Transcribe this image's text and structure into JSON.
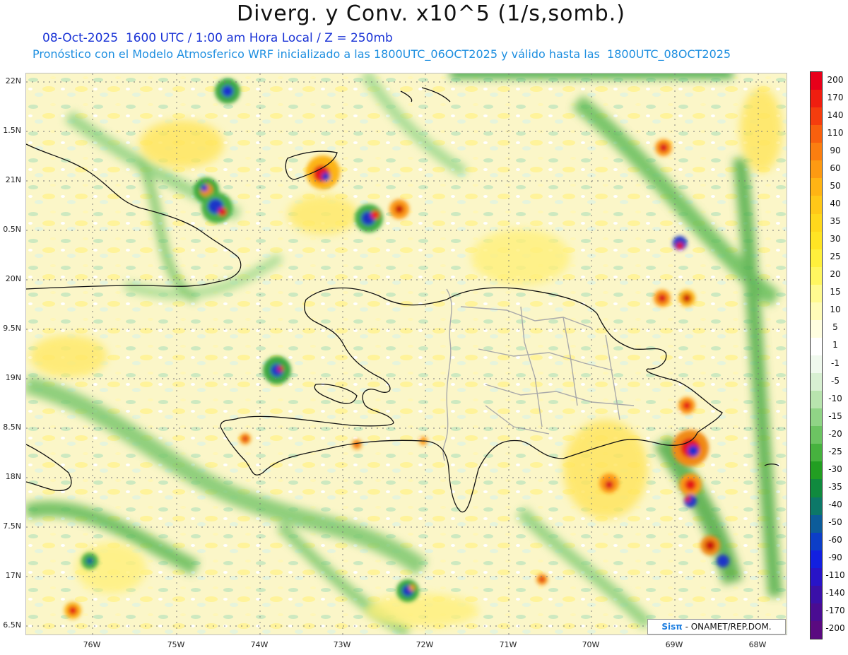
{
  "header": {
    "title": "Diverg. y Conv. x10^5 (1/s,somb.)",
    "line1": "08-Oct-2025  1600 UTC / 1:00 am Hora Local / Z = 250mb",
    "line2": "Pronóstico con el Modelo Atmosferico WRF inicializado a las 1800UTC_06OCT2025 y válido hasta las  1800UTC_08OCT2025"
  },
  "axes": {
    "lat_labels": [
      "22N",
      "1.5N",
      "21N",
      "0.5N",
      "20N",
      "9.5N",
      "19N",
      "8.5N",
      "18N",
      "7.5N",
      "17N",
      "6.5N"
    ],
    "lon_labels": [
      "76W",
      "75W",
      "74W",
      "73W",
      "72W",
      "71W",
      "70W",
      "69W",
      "68W"
    ]
  },
  "colorbar": {
    "labels": [
      "200",
      "170",
      "140",
      "110",
      "90",
      "60",
      "50",
      "40",
      "35",
      "30",
      "25",
      "20",
      "15",
      "10",
      "5",
      "1",
      "-1",
      "-5",
      "-10",
      "-15",
      "-20",
      "-25",
      "-30",
      "-35",
      "-40",
      "-50",
      "-60",
      "-90",
      "-110",
      "-140",
      "-170",
      "-200"
    ],
    "colors": [
      "#e8001a",
      "#f01e10",
      "#f53d0e",
      "#f8600e",
      "#fb7e10",
      "#fd9a12",
      "#ffb414",
      "#ffc818",
      "#ffd81c",
      "#ffe424",
      "#fff03c",
      "#fff660",
      "#fffa90",
      "#fffcb8",
      "#fffee0",
      "#ffffff",
      "#f0f9ee",
      "#d8f0d2",
      "#b8e4ae",
      "#90d486",
      "#6cc462",
      "#46b23e",
      "#229e22",
      "#108a3e",
      "#0c7868",
      "#0c5c9a",
      "#0c3ec8",
      "#1220e0",
      "#2814c8",
      "#3a10a8",
      "#4a0c92",
      "#5a0a80"
    ]
  },
  "credit": {
    "logo": "Sisπ",
    "text": " - ONAMET/REP.DOM."
  }
}
